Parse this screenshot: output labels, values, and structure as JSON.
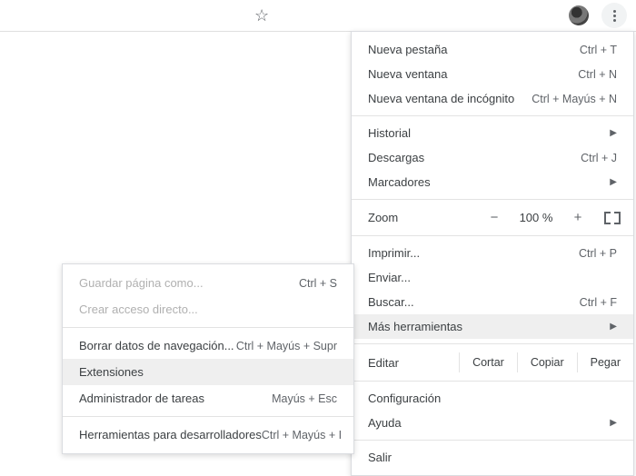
{
  "toolbar": {
    "star": "☆"
  },
  "menu": {
    "new_tab": "Nueva pestaña",
    "new_tab_sc": "Ctrl + T",
    "new_window": "Nueva ventana",
    "new_window_sc": "Ctrl + N",
    "incognito": "Nueva ventana de incógnito",
    "incognito_sc": "Ctrl + Mayús + N",
    "history": "Historial",
    "downloads": "Descargas",
    "downloads_sc": "Ctrl + J",
    "bookmarks": "Marcadores",
    "zoom": "Zoom",
    "zoom_val": "100 %",
    "print": "Imprimir...",
    "print_sc": "Ctrl + P",
    "cast": "Enviar...",
    "find": "Buscar...",
    "find_sc": "Ctrl + F",
    "more_tools": "Más herramientas",
    "edit": "Editar",
    "cut": "Cortar",
    "copy": "Copiar",
    "paste": "Pegar",
    "settings": "Configuración",
    "help": "Ayuda",
    "exit": "Salir"
  },
  "submenu": {
    "save_as": "Guardar página como...",
    "save_as_sc": "Ctrl + S",
    "shortcut": "Crear acceso directo...",
    "clear_data": "Borrar datos de navegación...",
    "clear_data_sc": "Ctrl + Mayús + Supr",
    "extensions": "Extensiones",
    "task_mgr": "Administrador de tareas",
    "task_mgr_sc": "Mayús + Esc",
    "devtools": "Herramientas para desarrolladores",
    "devtools_sc": "Ctrl + Mayús + I"
  }
}
